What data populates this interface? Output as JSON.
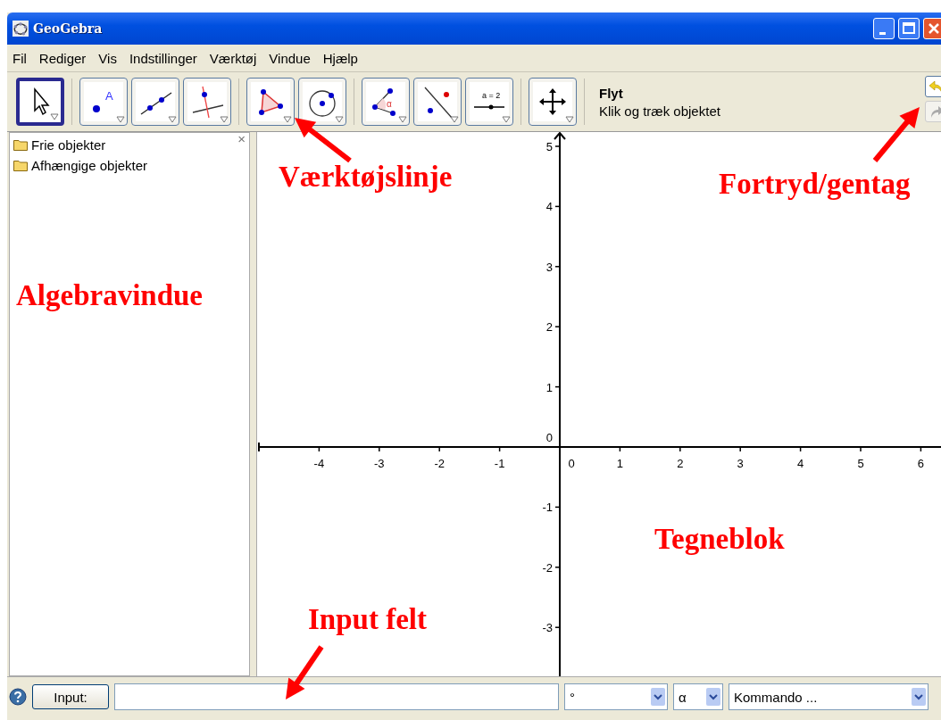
{
  "window": {
    "title": "GeoGebra"
  },
  "menu": [
    "Fil",
    "Rediger",
    "Vis",
    "Indstillinger",
    "Værktøj",
    "Vindue",
    "Hjælp"
  ],
  "toolbar": {
    "groups": [
      [
        {
          "kind": "move",
          "selected": true
        }
      ],
      [
        {
          "kind": "point",
          "selected": false,
          "label": "A"
        },
        {
          "kind": "line",
          "selected": false
        },
        {
          "kind": "perpendicular",
          "selected": false
        }
      ],
      [
        {
          "kind": "polygon",
          "selected": false
        },
        {
          "kind": "circle",
          "selected": false
        }
      ],
      [
        {
          "kind": "angle",
          "selected": false,
          "label": "α"
        },
        {
          "kind": "reflect",
          "selected": false
        },
        {
          "kind": "slider",
          "selected": false,
          "label": "a = 2"
        }
      ],
      [
        {
          "kind": "move-view",
          "selected": false
        }
      ]
    ],
    "tool_name": "Flyt",
    "tool_help": "Klik og træk objektet",
    "undo": {
      "disabled": false
    },
    "redo": {
      "disabled": true
    }
  },
  "algebra": {
    "close": "×",
    "items": [
      "Frie objekter",
      "Afhængige objekter"
    ]
  },
  "graphics": {
    "x_labels": [
      "-4",
      "-3",
      "-2",
      "-1",
      "0",
      "1",
      "2",
      "3",
      "4",
      "5",
      "6"
    ],
    "y_labels": [
      "5",
      "4",
      "3",
      "2",
      "1",
      "0",
      "-1",
      "-2",
      "-3"
    ]
  },
  "input_bar": {
    "button": "Input:",
    "degree": "°",
    "alpha": "α",
    "command": "Kommando ..."
  },
  "annotations": [
    {
      "kind": "toolbar",
      "text": "Værktøjslinje"
    },
    {
      "kind": "undo",
      "text": "Fortryd/gentag"
    },
    {
      "kind": "algebra",
      "text": "Algebravindue"
    },
    {
      "kind": "graphics",
      "text": "Tegneblok"
    },
    {
      "kind": "input",
      "text": "Input felt"
    }
  ]
}
